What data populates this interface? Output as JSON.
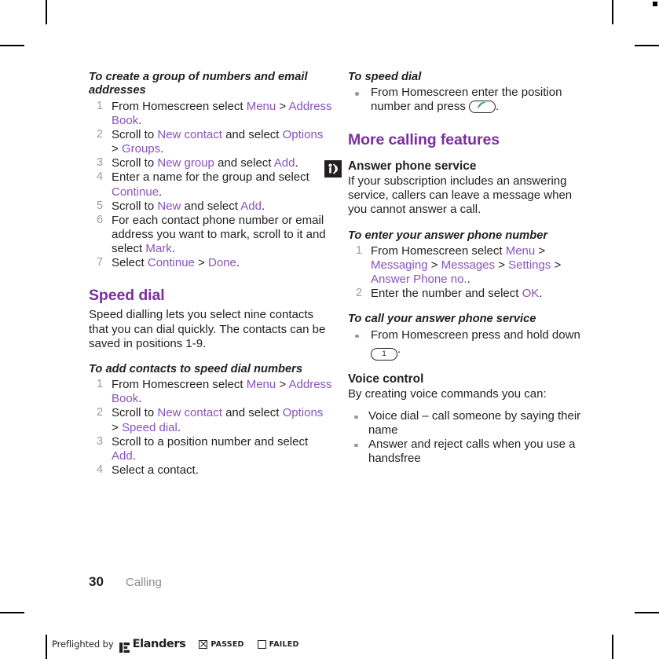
{
  "footer": {
    "page_number": "30",
    "chapter": "Calling"
  },
  "preflight": {
    "text": "Preflighted by",
    "brand": "Elanders",
    "passed_label": "PASSED",
    "failed_label": "FAILED"
  },
  "colors": {
    "heading_purple": "#7a2f9e",
    "reference_violet": "#8a53b8",
    "body_black": "#231f20",
    "step_number_gray": "#9b9b9b",
    "chapter_gray": "#8d8d8d",
    "call_key_green": "#17a34a"
  },
  "left_column": {
    "task_create_group": {
      "heading": "To create a group of numbers and email addresses",
      "steps": [
        {
          "parts": [
            {
              "t": "From Homescreen select ",
              "s": "body"
            },
            {
              "t": "Menu",
              "s": "ref"
            },
            {
              "t": " > ",
              "s": "body"
            },
            {
              "t": "Address Book",
              "s": "ref"
            },
            {
              "t": ".",
              "s": "body"
            }
          ]
        },
        {
          "parts": [
            {
              "t": "Scroll to ",
              "s": "body"
            },
            {
              "t": "New contact",
              "s": "ref"
            },
            {
              "t": " and select ",
              "s": "body"
            },
            {
              "t": "Options",
              "s": "ref"
            },
            {
              "t": " > ",
              "s": "body"
            },
            {
              "t": "Groups",
              "s": "ref"
            },
            {
              "t": ".",
              "s": "body"
            }
          ]
        },
        {
          "parts": [
            {
              "t": "Scroll to ",
              "s": "body"
            },
            {
              "t": "New group",
              "s": "ref"
            },
            {
              "t": " and select ",
              "s": "body"
            },
            {
              "t": "Add",
              "s": "ref"
            },
            {
              "t": ".",
              "s": "body"
            }
          ]
        },
        {
          "parts": [
            {
              "t": "Enter a name for the group and select ",
              "s": "body"
            },
            {
              "t": "Continue",
              "s": "ref"
            },
            {
              "t": ".",
              "s": "body"
            }
          ]
        },
        {
          "parts": [
            {
              "t": "Scroll to ",
              "s": "body"
            },
            {
              "t": "New",
              "s": "ref"
            },
            {
              "t": " and select ",
              "s": "body"
            },
            {
              "t": "Add",
              "s": "ref"
            },
            {
              "t": ".",
              "s": "body"
            }
          ]
        },
        {
          "parts": [
            {
              "t": "For each contact phone number or email address you want to mark, scroll to it and select ",
              "s": "body"
            },
            {
              "t": "Mark",
              "s": "ref"
            },
            {
              "t": ".",
              "s": "body"
            }
          ]
        },
        {
          "parts": [
            {
              "t": "Select ",
              "s": "body"
            },
            {
              "t": "Continue",
              "s": "ref"
            },
            {
              "t": " > ",
              "s": "body"
            },
            {
              "t": "Done",
              "s": "ref"
            },
            {
              "t": ".",
              "s": "body"
            }
          ]
        }
      ]
    },
    "speed_dial": {
      "heading": "Speed dial",
      "intro": "Speed dialling lets you select nine contacts that you can dial quickly. The contacts can be saved in positions 1-9.",
      "task_add": {
        "heading": "To add contacts to speed dial numbers",
        "steps": [
          {
            "parts": [
              {
                "t": "From Homescreen select ",
                "s": "body"
              },
              {
                "t": "Menu",
                "s": "ref"
              },
              {
                "t": " > ",
                "s": "body"
              },
              {
                "t": "Address Book",
                "s": "ref"
              },
              {
                "t": ".",
                "s": "body"
              }
            ]
          },
          {
            "parts": [
              {
                "t": "Scroll to ",
                "s": "body"
              },
              {
                "t": "New contact",
                "s": "ref"
              },
              {
                "t": " and select ",
                "s": "body"
              },
              {
                "t": "Options",
                "s": "ref"
              },
              {
                "t": " > ",
                "s": "body"
              },
              {
                "t": "Speed dial",
                "s": "ref"
              },
              {
                "t": ".",
                "s": "body"
              }
            ]
          },
          {
            "parts": [
              {
                "t": "Scroll to a position number and select ",
                "s": "body"
              },
              {
                "t": "Add",
                "s": "ref"
              },
              {
                "t": ".",
                "s": "body"
              }
            ]
          },
          {
            "parts": [
              {
                "t": "Select a contact.",
                "s": "body"
              }
            ]
          }
        ]
      }
    }
  },
  "right_column": {
    "task_speed_dial": {
      "heading": "To speed dial",
      "bullet_prefix": "From Homescreen enter the position number and press ",
      "bullet_suffix": ".",
      "key_icon": "call-key-icon"
    },
    "more_calling_features": {
      "heading": "More calling features"
    },
    "answer_phone_service": {
      "icon": "answer-phone-icon",
      "heading": "Answer phone service",
      "body": "If your subscription includes an answering service, callers can leave a message when you cannot answer a call.",
      "task_enter_number": {
        "heading": "To enter your answer phone number",
        "steps": [
          {
            "parts": [
              {
                "t": "From Homescreen select ",
                "s": "body"
              },
              {
                "t": "Menu",
                "s": "ref"
              },
              {
                "t": " > ",
                "s": "body"
              },
              {
                "t": "Messaging",
                "s": "ref"
              },
              {
                "t": " > ",
                "s": "body"
              },
              {
                "t": "Messages",
                "s": "ref"
              },
              {
                "t": " > ",
                "s": "body"
              },
              {
                "t": "Settings",
                "s": "ref"
              },
              {
                "t": " > ",
                "s": "body"
              },
              {
                "t": "Answer Phone no.",
                "s": "ref"
              },
              {
                "t": ".",
                "s": "body"
              }
            ]
          },
          {
            "parts": [
              {
                "t": "Enter the number and select ",
                "s": "body"
              },
              {
                "t": "OK",
                "s": "ref"
              },
              {
                "t": ".",
                "s": "body"
              }
            ]
          }
        ]
      },
      "task_call_service": {
        "heading": "To call your answer phone service",
        "bullet_prefix": "From Homescreen press and hold down ",
        "bullet_suffix": ".",
        "key_label": "1",
        "key_icon": "key-1-icon"
      }
    },
    "voice_control": {
      "heading": "Voice control",
      "intro": "By creating voice commands you can:",
      "bullets": [
        "Voice dial – call someone by saying their name",
        "Answer and reject calls when you use a handsfree"
      ]
    }
  }
}
